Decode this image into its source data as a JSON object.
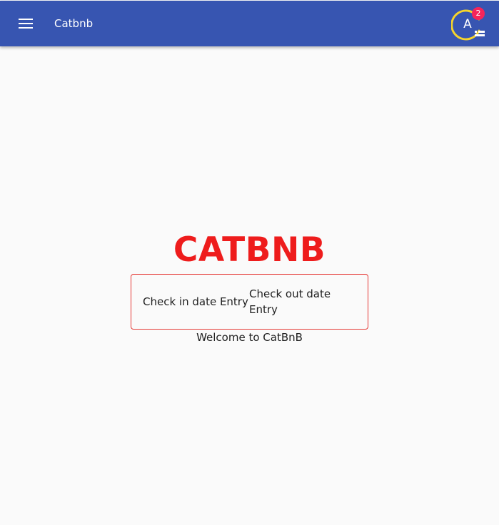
{
  "app_bar": {
    "title": "Catbnb",
    "menu_icon": "menu-icon",
    "background_color": "#3755b1"
  },
  "account": {
    "avatar_letter": "A",
    "notification_count": "2",
    "ring_color": "#f5d42c",
    "badge_color": "#f5245a",
    "status_icon": "list-icon"
  },
  "main": {
    "brand_title": "CATBNB",
    "brand_color": "#ee1c1c",
    "checkin_label": "Check in date Entry",
    "checkout_label": "Check out date Entry",
    "welcome_text": "Welcome to CatBnB"
  }
}
